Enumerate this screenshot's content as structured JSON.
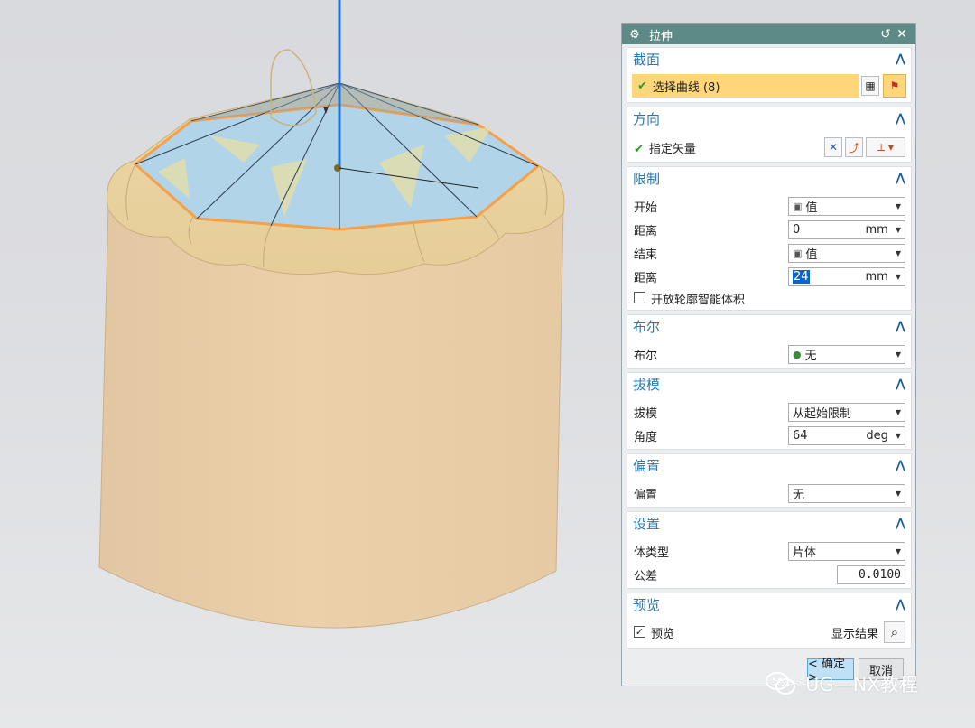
{
  "dialog": {
    "title": "拉伸",
    "reset_symbol": "↺",
    "close_symbol": "✕"
  },
  "sections": {
    "section_curve": {
      "title": "截面",
      "select_curve": "选择曲线 (8)"
    },
    "direction": {
      "title": "方向",
      "vector": "指定矢量"
    },
    "limits": {
      "title": "限制",
      "start_label": "开始",
      "start_value": "值",
      "start_dist_label": "距离",
      "start_dist": "0",
      "start_unit": "mm",
      "end_label": "结束",
      "end_value": "值",
      "end_dist_label": "距离",
      "end_dist": "24",
      "end_unit": "mm",
      "open_profile": "开放轮廓智能体积"
    },
    "boolean": {
      "title": "布尔",
      "label": "布尔",
      "value": "无"
    },
    "draft": {
      "title": "拔模",
      "label": "拔模",
      "value": "从起始限制",
      "angle_label": "角度",
      "angle": "64",
      "angle_unit": "deg"
    },
    "offset": {
      "title": "偏置",
      "label": "偏置",
      "value": "无"
    },
    "settings": {
      "title": "设置",
      "body_type_label": "体类型",
      "body_type": "片体",
      "tolerance_label": "公差",
      "tolerance": "0.0100"
    },
    "preview": {
      "title": "预览",
      "checkbox": "预览",
      "show_result": "显示结果"
    }
  },
  "buttons": {
    "ok": "< 确定 >",
    "cancel": "取消"
  },
  "watermark": "UG—NX教程",
  "colors": {
    "title_bar": "#5d8a87",
    "section_title": "#2a78b0",
    "selection_highlight": "#ffd77a",
    "ok_button": "#bfe0f5",
    "model_body": "#e9cda7",
    "top_face": "#aed4ec",
    "edge_highlight": "#f5a04a",
    "vector": "#1e73d2"
  }
}
